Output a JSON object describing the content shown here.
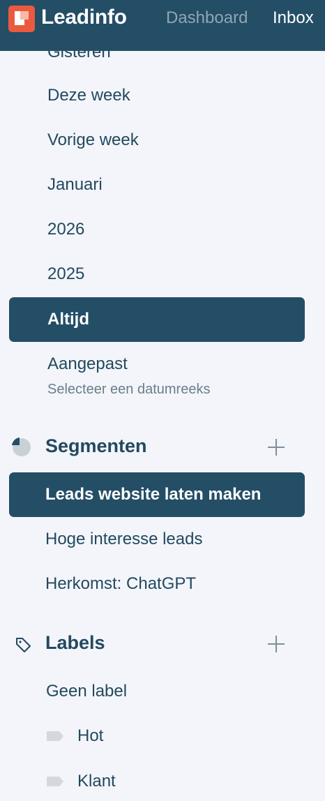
{
  "app": {
    "logo_text": "Leadinfo"
  },
  "nav": {
    "dashboard": "Dashboard",
    "inbox": "Inbox"
  },
  "periods": {
    "clipped": "Gisteren",
    "items": [
      "Deze week",
      "Vorige week",
      "Januari",
      "2026",
      "2025"
    ],
    "selected": "Altijd",
    "custom": {
      "label": "Aangepast",
      "hint": "Selecteer een datumreeks"
    }
  },
  "segments": {
    "title": "Segmenten",
    "selected": "Leads website laten maken",
    "items": [
      "Hoge interesse leads",
      "Herkomst: ChatGPT"
    ]
  },
  "labels": {
    "title": "Labels",
    "no_label": "Geen label",
    "items": [
      "Hot",
      "Klant"
    ]
  },
  "colors": {
    "primary": "#244e66",
    "background": "#f3f5fa",
    "brand": "#ea5a3f",
    "text": "#23495f"
  }
}
